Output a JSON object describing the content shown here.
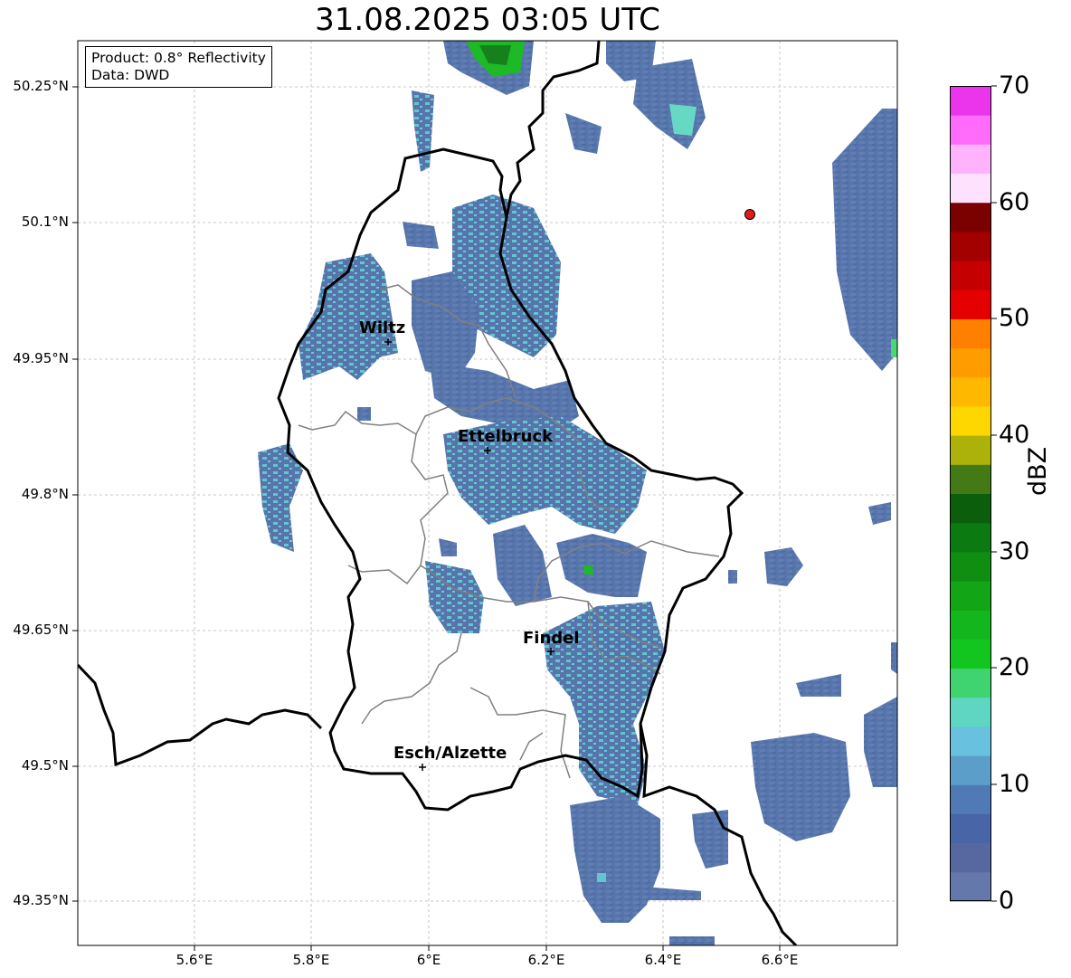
{
  "title": "31.08.2025 03:05 UTC",
  "info_box": {
    "product": "Product: 0.8° Reflectivity",
    "data": "Data: DWD"
  },
  "map": {
    "lat_labels": [
      "50.25°N",
      "50.1°N",
      "49.95°N",
      "49.8°N",
      "49.65°N",
      "49.5°N",
      "49.35°N"
    ],
    "lon_labels": [
      "5.6°E",
      "5.8°E",
      "6°E",
      "6.2°E",
      "6.4°E",
      "6.6°E"
    ],
    "cities": [
      {
        "name": "Wiltz"
      },
      {
        "name": "Ettelbruck"
      },
      {
        "name": "Findel"
      },
      {
        "name": "Esch/Alzette"
      }
    ],
    "marker": "red-dot"
  },
  "colorbar": {
    "label": "dBZ",
    "ticks": [
      "0",
      "10",
      "20",
      "30",
      "40",
      "50",
      "60",
      "70"
    ],
    "colors": [
      "#6578ab",
      "#56689f",
      "#4865a8",
      "#4f7ab6",
      "#5b9ec9",
      "#68c1de",
      "#5fd6c1",
      "#3fd46f",
      "#13c61f",
      "#13b61c",
      "#12a516",
      "#0f8e12",
      "#0b7a10",
      "#0a5e0c",
      "#447a16",
      "#adb20b",
      "#fed600",
      "#ffb800",
      "#ff9c00",
      "#ff7f00",
      "#e40000",
      "#c50000",
      "#a30000",
      "#7b0000",
      "#fde1fd",
      "#ffb3fd",
      "#ff6cfb",
      "#eb35ec"
    ]
  },
  "colors": {
    "border_country": "#000000",
    "border_canton": "#808080",
    "radar": "#4e6ea6",
    "radar_light": "#5bc4cc",
    "radar_green": "#13b61c",
    "marker": "#e41a1c"
  }
}
